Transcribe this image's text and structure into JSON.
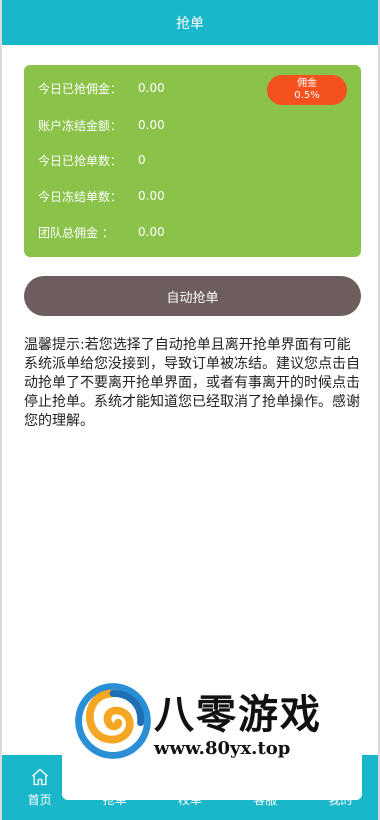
{
  "header": {
    "title": "抢单"
  },
  "stats": {
    "rows": [
      {
        "label": "今日已抢佣金：",
        "value": "0.00"
      },
      {
        "label": "账户冻结金额：",
        "value": "0.00"
      },
      {
        "label": "今日已抢单数：",
        "value": "0"
      },
      {
        "label": "今日冻结单数：",
        "value": "0.00"
      },
      {
        "label": "团队总佣金 ：",
        "value": "0.00"
      }
    ],
    "commission": {
      "label": "佣金",
      "rate": "0.5%"
    }
  },
  "auto_button": {
    "label": "自动抢单"
  },
  "notice": {
    "text": "温馨提示:若您选择了自动抢单且离开抢单界面有可能系统派单给您没接到，导致订单被冻结。建议您点击自动抢单了不要离开抢单界面，或者有事离开的时候点击停止抢单。系统才能知道您已经取消了抢单操作。感谢您的理解。"
  },
  "tabbar": {
    "items": [
      {
        "label": "首页",
        "icon": "home-icon"
      },
      {
        "label": "抢单",
        "icon": "grab-icon"
      },
      {
        "label": "校单",
        "icon": "list-icon"
      },
      {
        "label": "客服",
        "icon": "service-icon"
      },
      {
        "label": "我的",
        "icon": "user-icon"
      }
    ]
  },
  "watermark": {
    "title": "八零游戏",
    "url": "www.80yx.top"
  },
  "colors": {
    "header": "#1ab6c9",
    "card": "#8bc34a",
    "badge": "#f4511e",
    "button": "#6d5d5d"
  }
}
